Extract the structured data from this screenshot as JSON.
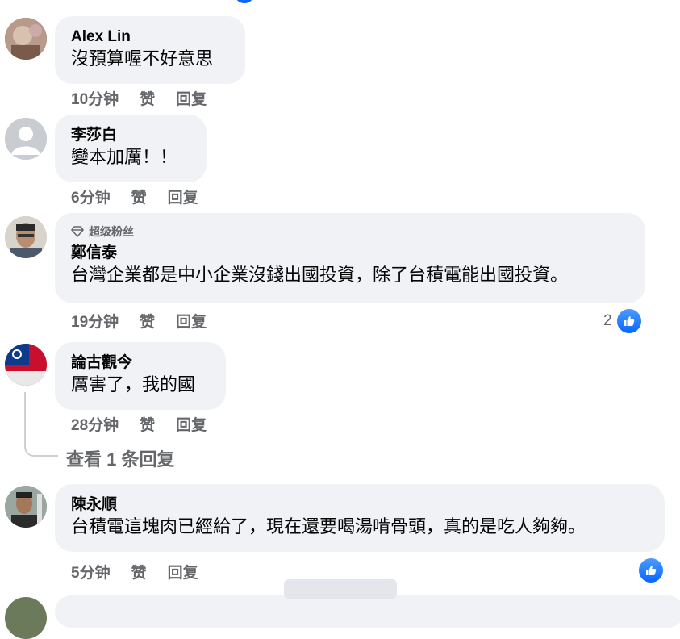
{
  "comments": [
    {
      "author": "Alex Lin",
      "text": "沒預算喔不好意思",
      "time": "10分钟",
      "like": "赞",
      "reply": "回复"
    },
    {
      "author": "李莎白",
      "text": "變本加厲！！",
      "time": "6分钟",
      "like": "赞",
      "reply": "回复"
    },
    {
      "badge": "超级粉丝",
      "author": "鄭信泰",
      "text": "台灣企業都是中小企業沒錢出國投資，除了台積電能出國投資。",
      "time": "19分钟",
      "like": "赞",
      "reply": "回复",
      "reaction_count": "2"
    },
    {
      "author": "論古觀今",
      "text": "厲害了，我的國",
      "time": "28分钟",
      "like": "赞",
      "reply": "回复"
    },
    {
      "author": "陳永順",
      "text": "台積電這塊肉已經給了，現在還要喝湯啃骨頭，真的是吃人夠夠。",
      "time": "5分钟",
      "like": "赞",
      "reply": "回复"
    }
  ],
  "view_replies": "查看 1 条回复",
  "colors": {
    "bubble": "#f0f2f5",
    "meta": "#65676b",
    "like_blue": "#0866ff"
  }
}
